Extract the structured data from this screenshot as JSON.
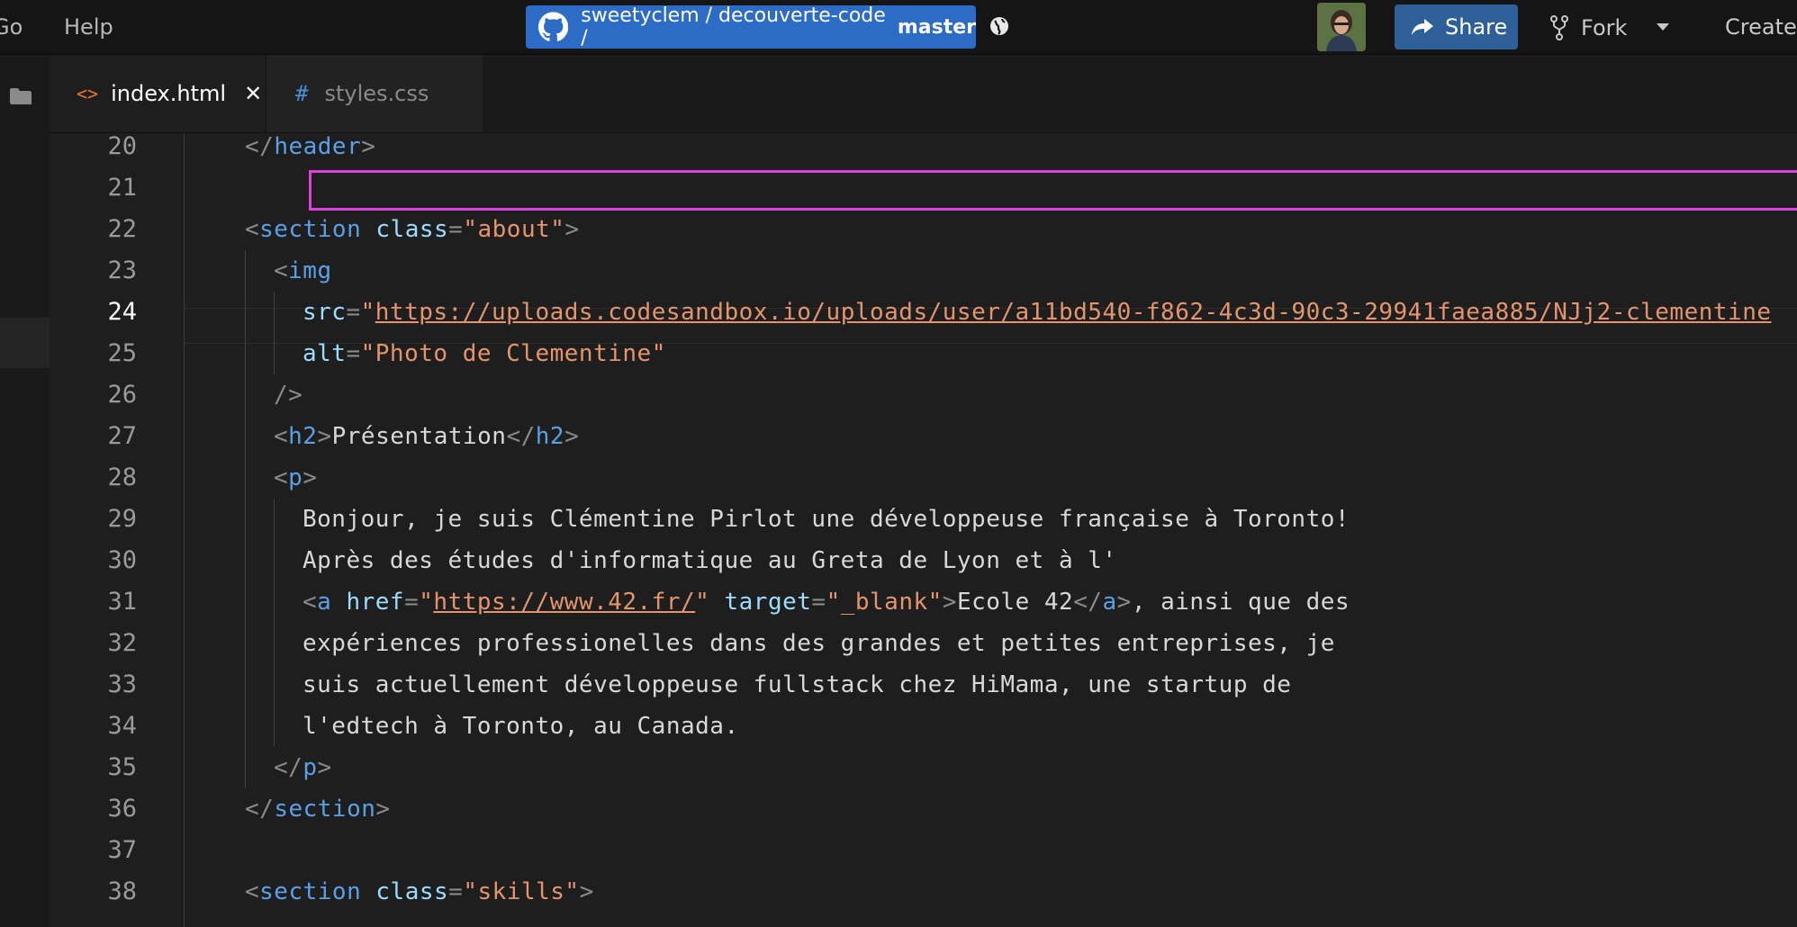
{
  "menu": {
    "go": "Go",
    "help": "Help"
  },
  "repo": {
    "owner_repo": "sweetyclem / decouverte-code /",
    "branch": "master"
  },
  "header": {
    "share_label": "Share",
    "fork_label": "Fork",
    "create_label": "Create"
  },
  "tabs": [
    {
      "label": "index.html",
      "icon": "<>",
      "active": true
    },
    {
      "label": "styles.css",
      "icon": "#",
      "active": false
    }
  ],
  "editor": {
    "current_line": 24,
    "lines": [
      {
        "n": "20",
        "indent": 0,
        "html": "<span class=\"t-punct\">&lt;/</span><span class=\"t-tag\">header</span><span class=\"t-punct\">&gt;</span>"
      },
      {
        "n": "21",
        "indent": 0,
        "html": ""
      },
      {
        "n": "22",
        "indent": 0,
        "html": "<span class=\"t-punct\">&lt;</span><span class=\"t-tag\">section</span> <span class=\"t-attr\">class</span><span class=\"t-punct\">=</span><span class=\"t-str\">\"about\"</span><span class=\"t-punct\">&gt;</span>"
      },
      {
        "n": "23",
        "indent": 1,
        "html": "<span class=\"t-punct\">&lt;</span><span class=\"t-tag\">img</span>"
      },
      {
        "n": "24",
        "indent": 2,
        "html": "<span class=\"t-attr\">src</span><span class=\"t-punct\">=</span><span class=\"t-str\">\"</span><span class=\"t-link\">https://uploads.codesandbox.io/uploads/user/a11bd540-f862-4c3d-90c3-29941faea885/NJj2-clementine</span>"
      },
      {
        "n": "25",
        "indent": 2,
        "html": "<span class=\"t-attr\">alt</span><span class=\"t-punct\">=</span><span class=\"t-str\">\"Photo de Clementine\"</span>"
      },
      {
        "n": "26",
        "indent": 1,
        "html": "<span class=\"t-punct\">/&gt;</span>"
      },
      {
        "n": "27",
        "indent": 1,
        "html": "<span class=\"t-punct\">&lt;</span><span class=\"t-tag\">h2</span><span class=\"t-punct\">&gt;</span><span class=\"t-text\">Présentation</span><span class=\"t-punct\">&lt;/</span><span class=\"t-tag\">h2</span><span class=\"t-punct\">&gt;</span>"
      },
      {
        "n": "28",
        "indent": 1,
        "html": "<span class=\"t-punct\">&lt;</span><span class=\"t-tag\">p</span><span class=\"t-punct\">&gt;</span>"
      },
      {
        "n": "29",
        "indent": 2,
        "html": "<span class=\"t-text\">Bonjour, je suis Clémentine Pirlot une développeuse française à Toronto!</span>"
      },
      {
        "n": "30",
        "indent": 2,
        "html": "<span class=\"t-text\">Après des études d'informatique au Greta de Lyon et à l'</span>"
      },
      {
        "n": "31",
        "indent": 2,
        "html": "<span class=\"t-punct\">&lt;</span><span class=\"t-tag\">a</span> <span class=\"t-attr\">href</span><span class=\"t-punct\">=</span><span class=\"t-str\">\"</span><span class=\"t-link\">https://www.42.fr/</span><span class=\"t-str\">\"</span> <span class=\"t-attr\">target</span><span class=\"t-punct\">=</span><span class=\"t-str\">\"_blank\"</span><span class=\"t-punct\">&gt;</span><span class=\"t-text\">Ecole 42</span><span class=\"t-punct\">&lt;/</span><span class=\"t-tag\">a</span><span class=\"t-punct\">&gt;</span><span class=\"t-text\">, ainsi que des</span>"
      },
      {
        "n": "32",
        "indent": 2,
        "html": "<span class=\"t-text\">expériences professionelles dans des grandes et petites entreprises, je</span>"
      },
      {
        "n": "33",
        "indent": 2,
        "html": "<span class=\"t-text\">suis actuellement développeuse fullstack chez HiMama, une startup de</span>"
      },
      {
        "n": "34",
        "indent": 2,
        "html": "<span class=\"t-text\">l'edtech à Toronto, au Canada.</span>"
      },
      {
        "n": "35",
        "indent": 1,
        "html": "<span class=\"t-punct\">&lt;/</span><span class=\"t-tag\">p</span><span class=\"t-punct\">&gt;</span>"
      },
      {
        "n": "36",
        "indent": 0,
        "html": "<span class=\"t-punct\">&lt;/</span><span class=\"t-tag\">section</span><span class=\"t-punct\">&gt;</span>"
      },
      {
        "n": "37",
        "indent": 0,
        "html": ""
      },
      {
        "n": "38",
        "indent": 0,
        "html": "<span class=\"t-punct\">&lt;</span><span class=\"t-tag\">section</span> <span class=\"t-attr\">class</span><span class=\"t-punct\">=</span><span class=\"t-str\">\"skills\"</span><span class=\"t-punct\">&gt;</span>"
      }
    ]
  },
  "colors": {
    "accent": "#2c6cc7",
    "share": "#2f5f98",
    "highlight": "#e040e0"
  }
}
